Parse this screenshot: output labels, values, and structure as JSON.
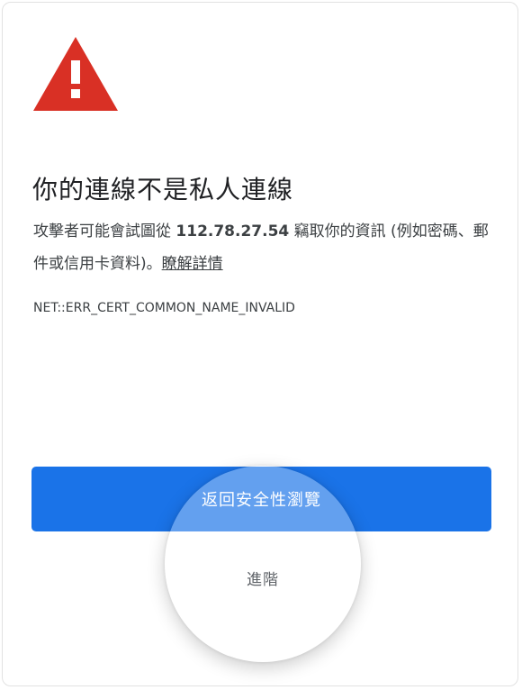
{
  "icon": {
    "name": "warning-triangle-icon",
    "color": "#d93025"
  },
  "title": "你的連線不是私人連線",
  "description": {
    "prefix": "攻擊者可能會試圖從 ",
    "host": "112.78.27.54",
    "suffix": " 竊取你的資訊 (例如密碼、郵件或信用卡資料)。",
    "learn_more": "瞭解詳情"
  },
  "error_code": "NET::ERR_CERT_COMMON_NAME_INVALID",
  "buttons": {
    "back_to_safety": "返回安全性瀏覽",
    "advanced": "進階"
  },
  "colors": {
    "primary": "#1a73e8",
    "warning": "#d93025",
    "text": "#202124",
    "secondary_text": "#5f6368"
  }
}
